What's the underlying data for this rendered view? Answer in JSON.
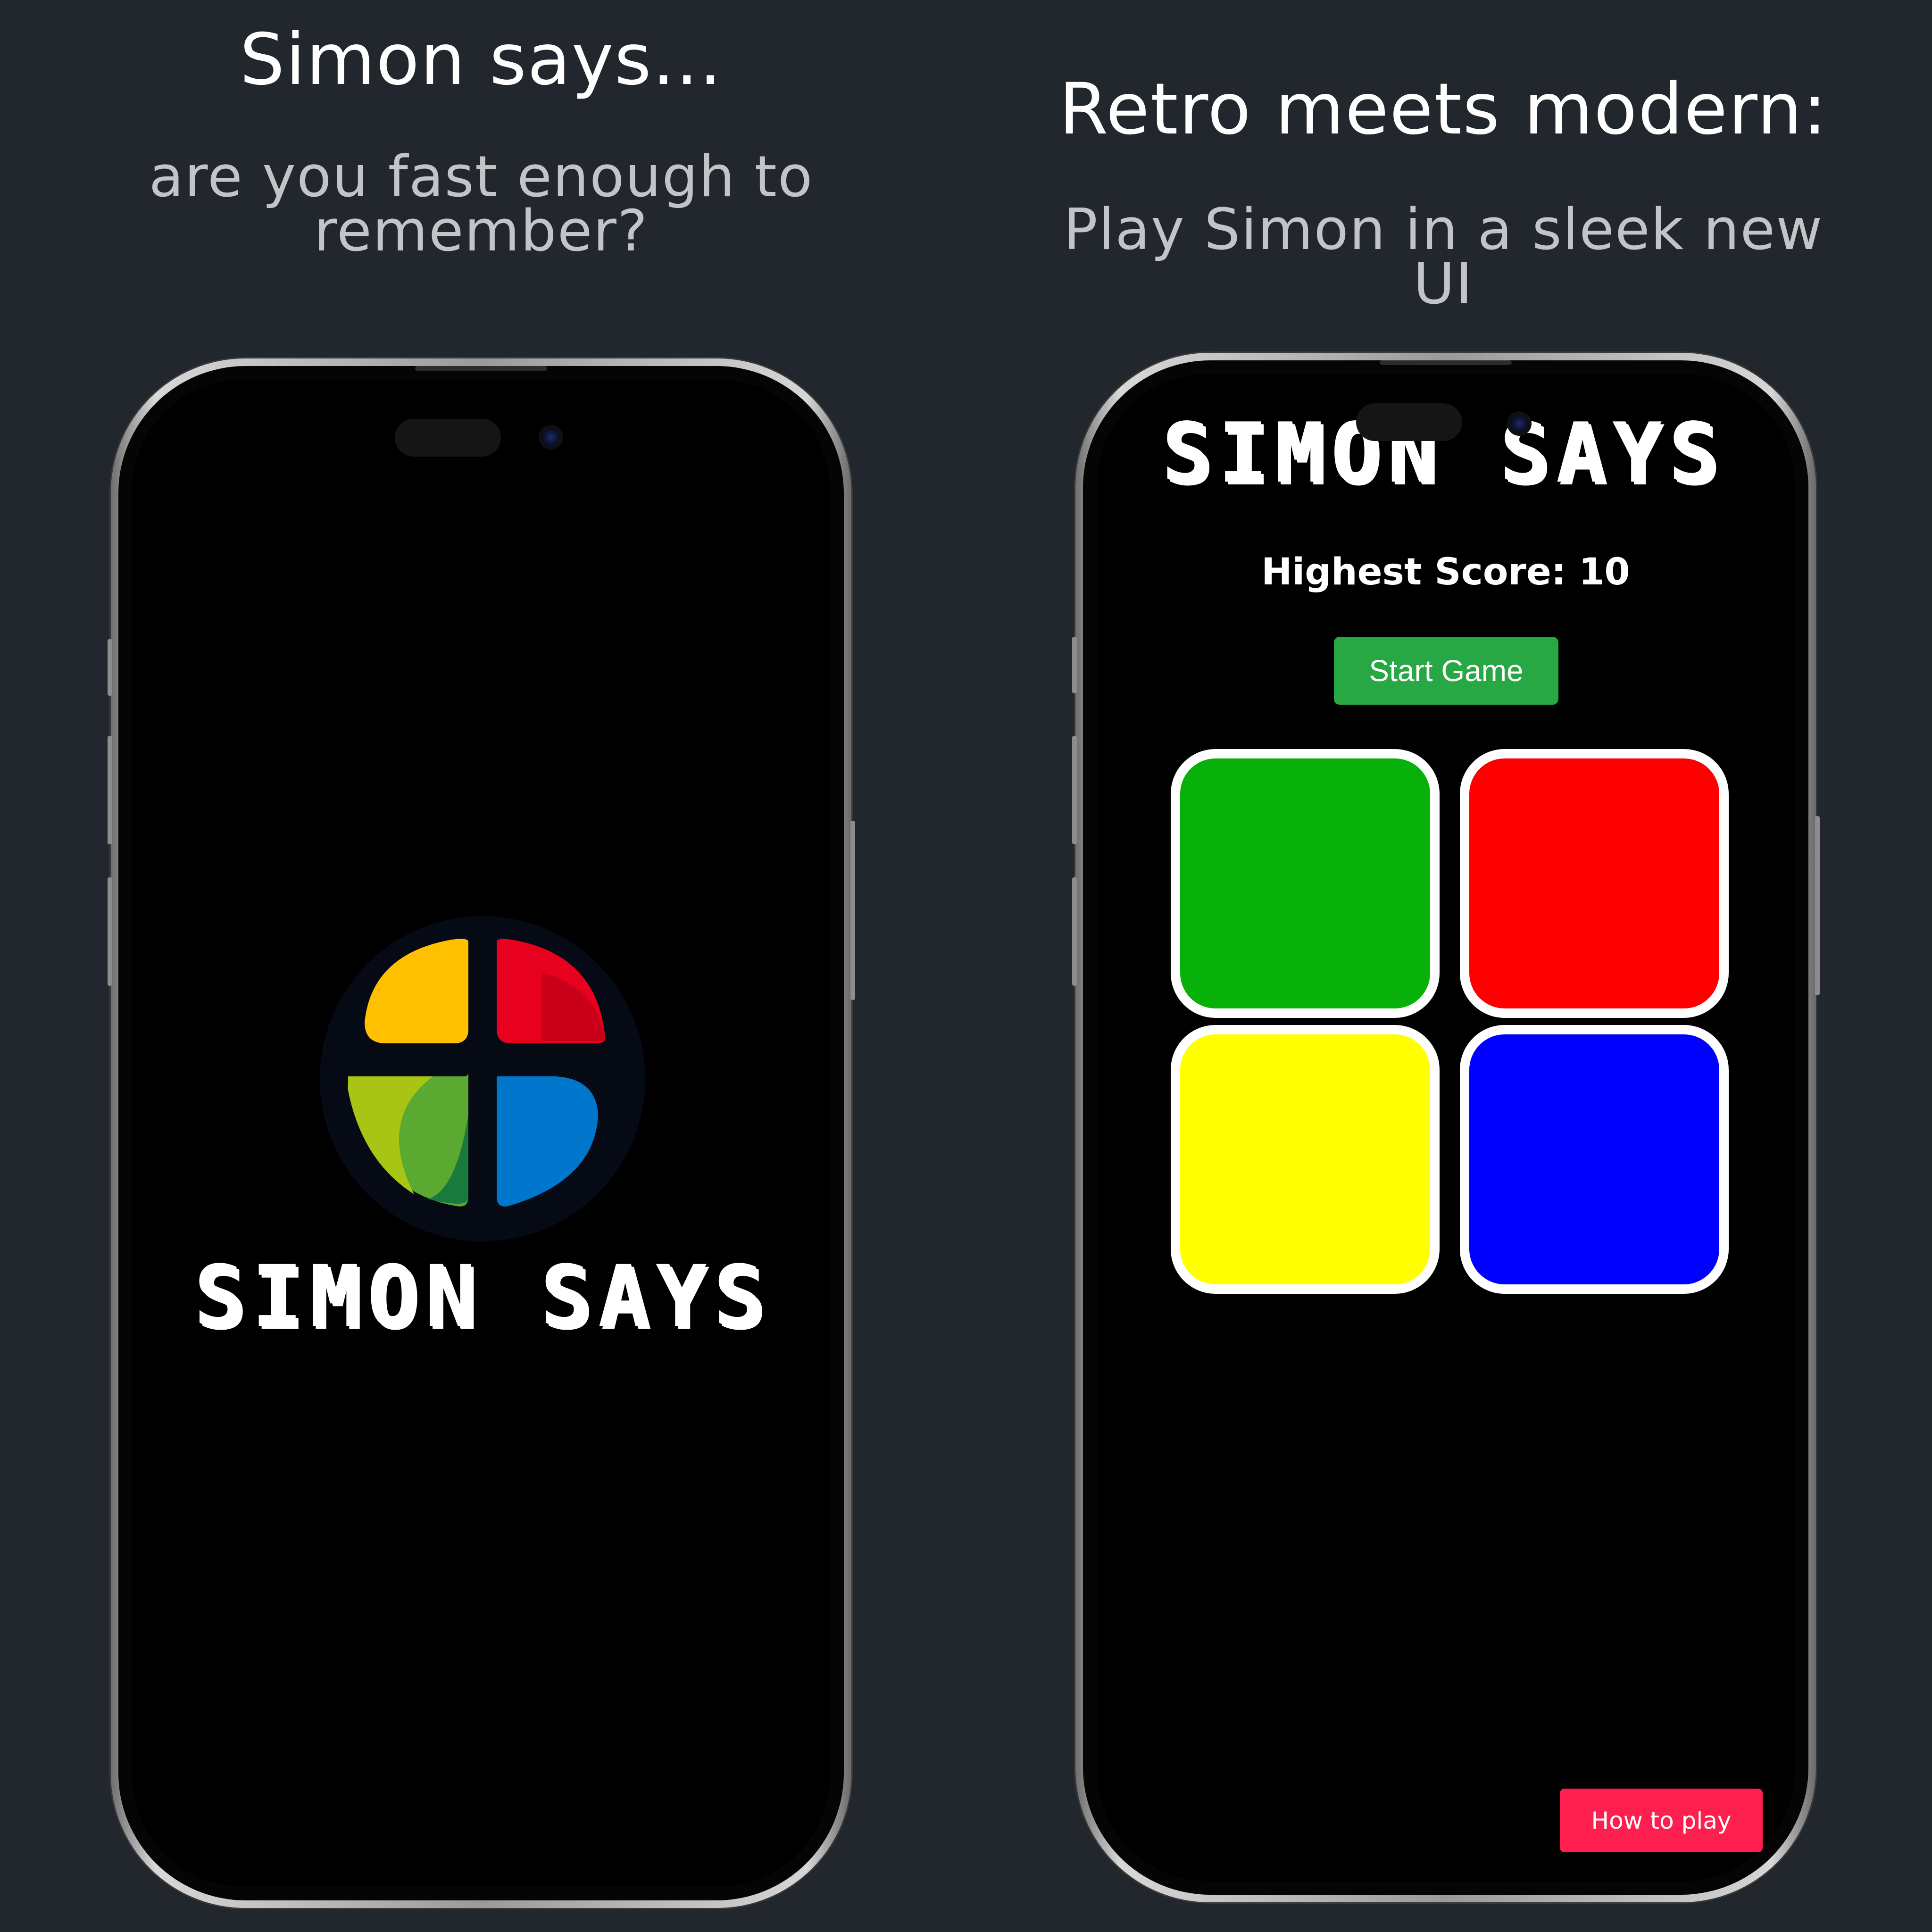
{
  "left_panel": {
    "headline": "Simon says...",
    "subline_1": "are you fast enough to",
    "subline_2": "remember?"
  },
  "right_panel": {
    "headline": "Retro meets modern:",
    "subline": "Play Simon in a sleek new UI"
  },
  "splash_screen": {
    "logo_icon": "simon-quadrant-logo-icon",
    "logo_colors": [
      "#ffc000",
      "#e8001f",
      "#5aaa32",
      "#0077cc"
    ],
    "title": "SIMON SAYS"
  },
  "game_screen": {
    "title": "SIMON SAYS",
    "score_label": "Highest Score: 10",
    "start_button": "Start Game",
    "pads": [
      {
        "name": "green",
        "color": "#08b00a"
      },
      {
        "name": "red",
        "color": "#ff0000"
      },
      {
        "name": "yellow",
        "color": "#ffff00"
      },
      {
        "name": "blue",
        "color": "#0000ff"
      }
    ],
    "how_to_play_button": "How to play",
    "accent_colors": {
      "start": "#28a745",
      "how_to_play": "#ff1f4f"
    }
  }
}
